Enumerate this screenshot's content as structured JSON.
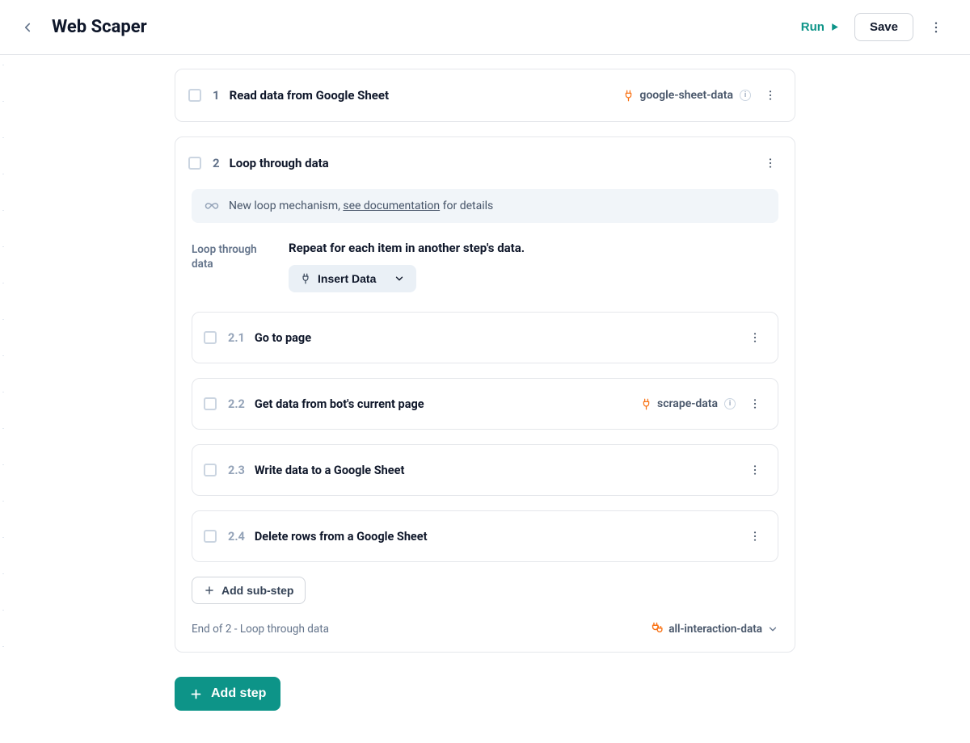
{
  "header": {
    "title": "Web Scaper",
    "run_label": "Run",
    "save_label": "Save"
  },
  "step1": {
    "number": "1",
    "title": "Read data from Google Sheet",
    "output_chip": "google-sheet-data"
  },
  "step2": {
    "number": "2",
    "title": "Loop through data",
    "banner_prefix": "New loop mechanism, ",
    "banner_link": "see documentation",
    "banner_suffix": " for details",
    "config_label": "Loop through data",
    "config_desc": "Repeat for each item in another step's data.",
    "insert_label": "Insert Data",
    "substeps": [
      {
        "num": "2.1",
        "title": "Go to page"
      },
      {
        "num": "2.2",
        "title": "Get data from bot's current page",
        "output_chip": "scrape-data"
      },
      {
        "num": "2.3",
        "title": "Write data to a Google Sheet"
      },
      {
        "num": "2.4",
        "title": "Delete rows from a Google Sheet"
      }
    ],
    "add_substep_label": "Add sub-step",
    "footer_left": "End of 2 - Loop through data",
    "footer_right_chip": "all-interaction-data"
  },
  "add_step_label": "Add step"
}
